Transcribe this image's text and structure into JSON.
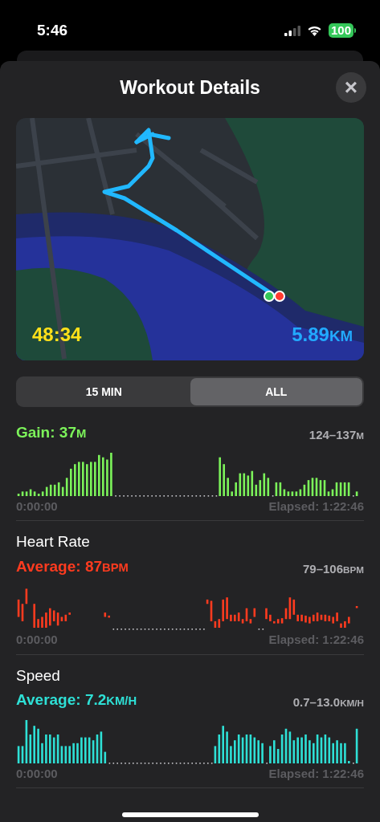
{
  "status_bar": {
    "time": "5:46",
    "battery": "100"
  },
  "sheet": {
    "title": "Workout Details",
    "close": "×"
  },
  "map": {
    "kind": "picture",
    "duration": "48:34",
    "distance": "5.89",
    "distance_unit": "KM"
  },
  "segments": [
    {
      "label": "15 MIN",
      "selected": false
    },
    {
      "label": "ALL",
      "selected": true
    }
  ],
  "metrics": [
    {
      "kind": "elevation",
      "summary": "Gain: 37",
      "summary_unit": "M",
      "range": "124–137",
      "range_unit": "M",
      "start": "0:00:00",
      "end": "Elapsed: 1:22:46"
    },
    {
      "kind": "heart",
      "title": "Heart Rate",
      "summary": "Average: 87",
      "summary_unit": "BPM",
      "range": "79–106",
      "range_unit": "BPM",
      "start": "0:00:00",
      "end": "Elapsed: 1:22:46"
    },
    {
      "kind": "speed",
      "title": "Speed",
      "summary": "Average: 7.2",
      "summary_unit": "KM/H",
      "range": "0.7–13.0",
      "range_unit": "KM/H",
      "start": "0:00:00",
      "end": "Elapsed: 1:22:46"
    }
  ]
}
